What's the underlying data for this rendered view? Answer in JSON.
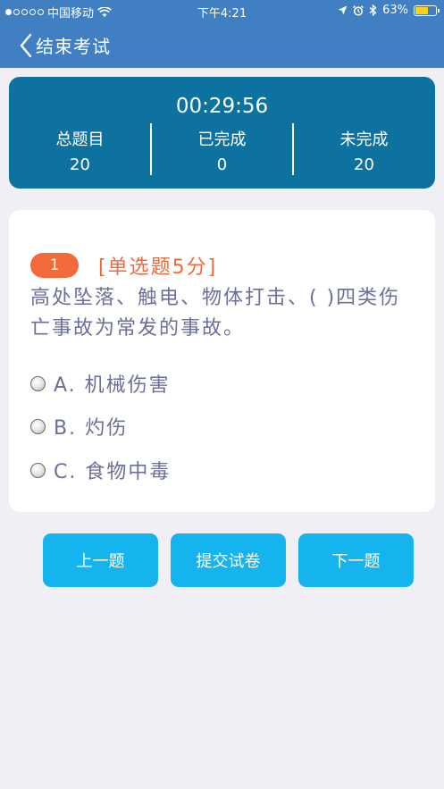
{
  "status_bar": {
    "carrier": "中国移动",
    "time": "下午4:21",
    "battery_text": "63%",
    "battery_level": 0.63,
    "battery_color": "#ffd21a"
  },
  "nav": {
    "back_label": "结束考试",
    "back_icon": "chevron-left-icon"
  },
  "summary": {
    "timer": "00:29:56",
    "total_label": "总题目",
    "total_value": "20",
    "done_label": "已完成",
    "done_value": "0",
    "undone_label": "未完成",
    "undone_value": "20"
  },
  "question": {
    "number": "1",
    "type": "[单选题5分]",
    "text": "高处坠落、触电、物体打击、( )四类伤亡事故为常发的事故。",
    "options": [
      {
        "label": "A. 机械伤害"
      },
      {
        "label": "B. 灼伤"
      },
      {
        "label": "C. 食物中毒"
      }
    ]
  },
  "buttons": {
    "prev": "上一题",
    "submit": "提交试卷",
    "next": "下一题"
  },
  "colors": {
    "nav_bg": "#3f7fc2",
    "summary_bg": "#0e72a0",
    "accent": "#f26a3a",
    "button_bg": "#16b4ee",
    "question_text": "#6b6f9a"
  }
}
